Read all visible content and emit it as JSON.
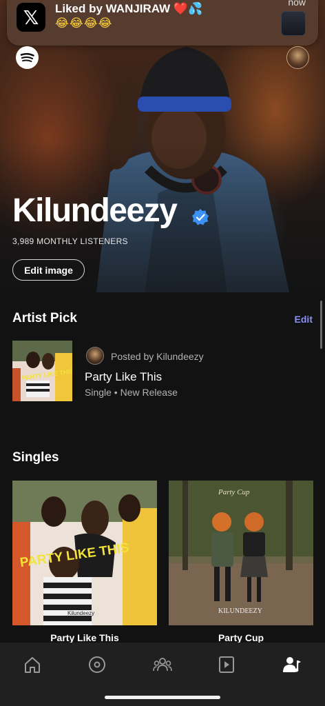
{
  "notification": {
    "app_icon": "x-logo-icon",
    "title": "Liked by WANJIRAW ❤️💦",
    "body": "😂😂😂😂",
    "time": "now"
  },
  "header": {
    "logo_icon": "spotify-logo-icon",
    "avatar_icon": "profile-avatar"
  },
  "artist": {
    "name": "Kilundeezy",
    "verified": true,
    "monthly_listeners": "3,989 MONTHLY LISTENERS",
    "edit_image_label": "Edit image"
  },
  "artist_pick": {
    "heading": "Artist Pick",
    "edit_label": "Edit",
    "posted_by": "Posted by Kilundeezy",
    "title": "Party Like This",
    "subtitle": "Single • New Release",
    "art_text": "PARTY LIKE THIS"
  },
  "singles": {
    "heading": "Singles",
    "items": [
      {
        "title": "Party Like This",
        "art_text": "PARTY LIKE THIS",
        "art_credit": "Kilundeezy"
      },
      {
        "title": "Party Cup",
        "art_text": "Party Cup",
        "art_credit": "KILUNDEEZY"
      }
    ]
  },
  "bottom_nav": {
    "items": [
      {
        "icon": "home-icon",
        "active": false
      },
      {
        "icon": "radio-icon",
        "active": false
      },
      {
        "icon": "audience-icon",
        "active": false
      },
      {
        "icon": "video-icon",
        "active": false
      },
      {
        "icon": "artist-profile-icon",
        "active": true
      }
    ]
  },
  "colors": {
    "background": "#121212",
    "accent_link": "#8a8ff5",
    "verified_badge": "#3d91f4",
    "nav_background": "#202020"
  }
}
